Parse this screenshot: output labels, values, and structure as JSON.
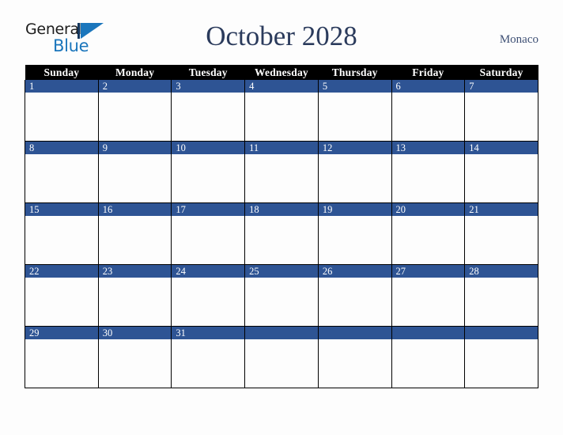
{
  "brand": {
    "name_part1": "General",
    "name_part2": "Blue",
    "mark_icon": "blue-triangle-icon",
    "colors": {
      "dark": "#1d1d1d",
      "blue": "#1b76bc"
    }
  },
  "header": {
    "title": "October 2028",
    "locale": "Monaco",
    "title_color": "#2b3b5c",
    "locale_color": "#3d4f74"
  },
  "calendar": {
    "month": "October",
    "year": "2028",
    "weekday_headers": [
      "Sunday",
      "Monday",
      "Tuesday",
      "Wednesday",
      "Thursday",
      "Friday",
      "Saturday"
    ],
    "header_bg": "#000000",
    "header_fg": "#ffffff",
    "daybar_bg": "#2e5494",
    "daybar_fg": "#ffffff",
    "cell_bg": "#fdfdfd",
    "border_color": "#000000",
    "weeks": [
      {
        "days": [
          {
            "number": "1"
          },
          {
            "number": "2"
          },
          {
            "number": "3"
          },
          {
            "number": "4"
          },
          {
            "number": "5"
          },
          {
            "number": "6"
          },
          {
            "number": "7"
          }
        ]
      },
      {
        "days": [
          {
            "number": "8"
          },
          {
            "number": "9"
          },
          {
            "number": "10"
          },
          {
            "number": "11"
          },
          {
            "number": "12"
          },
          {
            "number": "13"
          },
          {
            "number": "14"
          }
        ]
      },
      {
        "days": [
          {
            "number": "15"
          },
          {
            "number": "16"
          },
          {
            "number": "17"
          },
          {
            "number": "18"
          },
          {
            "number": "19"
          },
          {
            "number": "20"
          },
          {
            "number": "21"
          }
        ]
      },
      {
        "days": [
          {
            "number": "22"
          },
          {
            "number": "23"
          },
          {
            "number": "24"
          },
          {
            "number": "25"
          },
          {
            "number": "26"
          },
          {
            "number": "27"
          },
          {
            "number": "28"
          }
        ]
      },
      {
        "days": [
          {
            "number": "29"
          },
          {
            "number": "30"
          },
          {
            "number": "31"
          },
          {
            "number": ""
          },
          {
            "number": ""
          },
          {
            "number": ""
          },
          {
            "number": ""
          }
        ]
      }
    ]
  }
}
